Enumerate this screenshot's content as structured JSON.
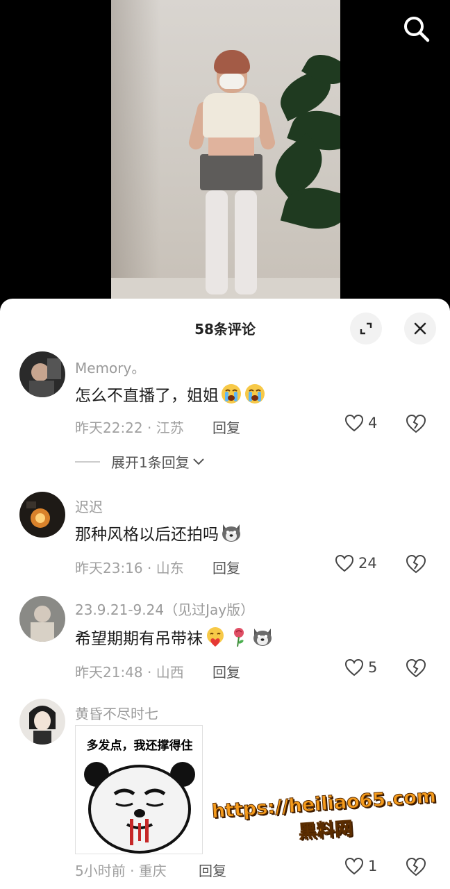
{
  "header": {
    "search_icon": "search-icon"
  },
  "sheet": {
    "title": "58条评论",
    "expand_icon": "expand-icon",
    "close_icon": "close-icon"
  },
  "comments": [
    {
      "username": "Memory。",
      "text": "怎么不直播了，姐姐",
      "emojis": [
        "loudly-crying-face",
        "loudly-crying-face"
      ],
      "time_location": "昨天22:22 · 江苏",
      "reply_label": "回复",
      "likes": "4",
      "expand_replies": "展开1条回复"
    },
    {
      "username": "迟迟",
      "text": "那种风格以后还拍吗",
      "emojis": [
        "husky-dog-face"
      ],
      "time_location": "昨天23:16 · 山东",
      "reply_label": "回复",
      "likes": "24"
    },
    {
      "username": "23.9.21-9.24（见过Jay版）",
      "text": "希望期期有吊带袜",
      "emojis": [
        "heart-hands-face",
        "rose",
        "husky-dog-face"
      ],
      "time_location": "昨天21:48 · 山西",
      "reply_label": "回复",
      "likes": "5"
    },
    {
      "username": "黄昏不尽时七",
      "sticker_caption": "多发点，我还撑得住",
      "time_location": "5小时前 · 重庆",
      "reply_label": "回复",
      "likes": "1"
    }
  ],
  "watermark": {
    "url": "https://heiliao65.com",
    "site": "黑料网"
  },
  "colors": {
    "sheet_bg": "#ffffff",
    "meta_gray": "#a0a0a0",
    "watermark_orange": "#f59b1c"
  }
}
